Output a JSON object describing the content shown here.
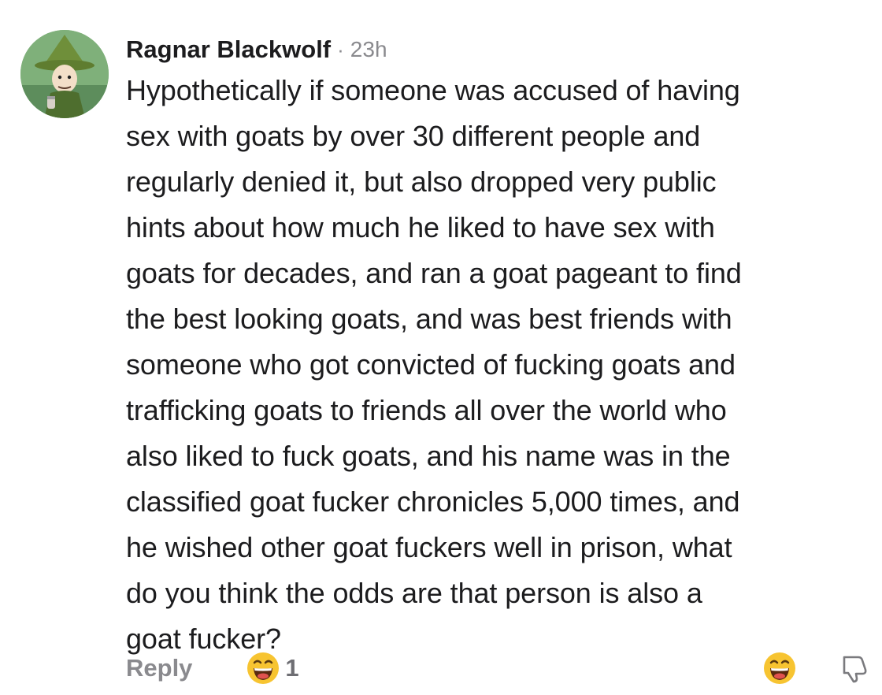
{
  "comment": {
    "author": "Ragnar Blackwolf",
    "separator": "·",
    "time": "23h",
    "avatar_icon": "snufkin-avatar",
    "text": "Hypothetically if someone was accused of having\nsex with goats by over 30 different people and\nregularly denied it, but also dropped very public\nhints about how much he liked to have sex with\ngoats for decades, and ran a goat pageant to find\nthe best looking goats, and was best friends with\nsomeone who got convicted of fucking goats and\ntrafficking goats to friends all over the world who\nalso liked to fuck goats, and his name was in the\nclassified goat fucker chronicles 5,000 times, and\nhe wished other goat fuckers well in prison, what\ndo you think the odds are that person is also a\ngoat fucker?"
  },
  "actions": {
    "reply_label": "Reply",
    "reaction_icon": "laughing-emoji-icon",
    "reaction_count": "1",
    "react_icon": "laughing-emoji-icon",
    "dislike_icon": "thumbs-down-icon"
  },
  "colors": {
    "text": "#1c1c1e",
    "muted": "#8a8a8e",
    "emoji_face": "#f7c431"
  }
}
